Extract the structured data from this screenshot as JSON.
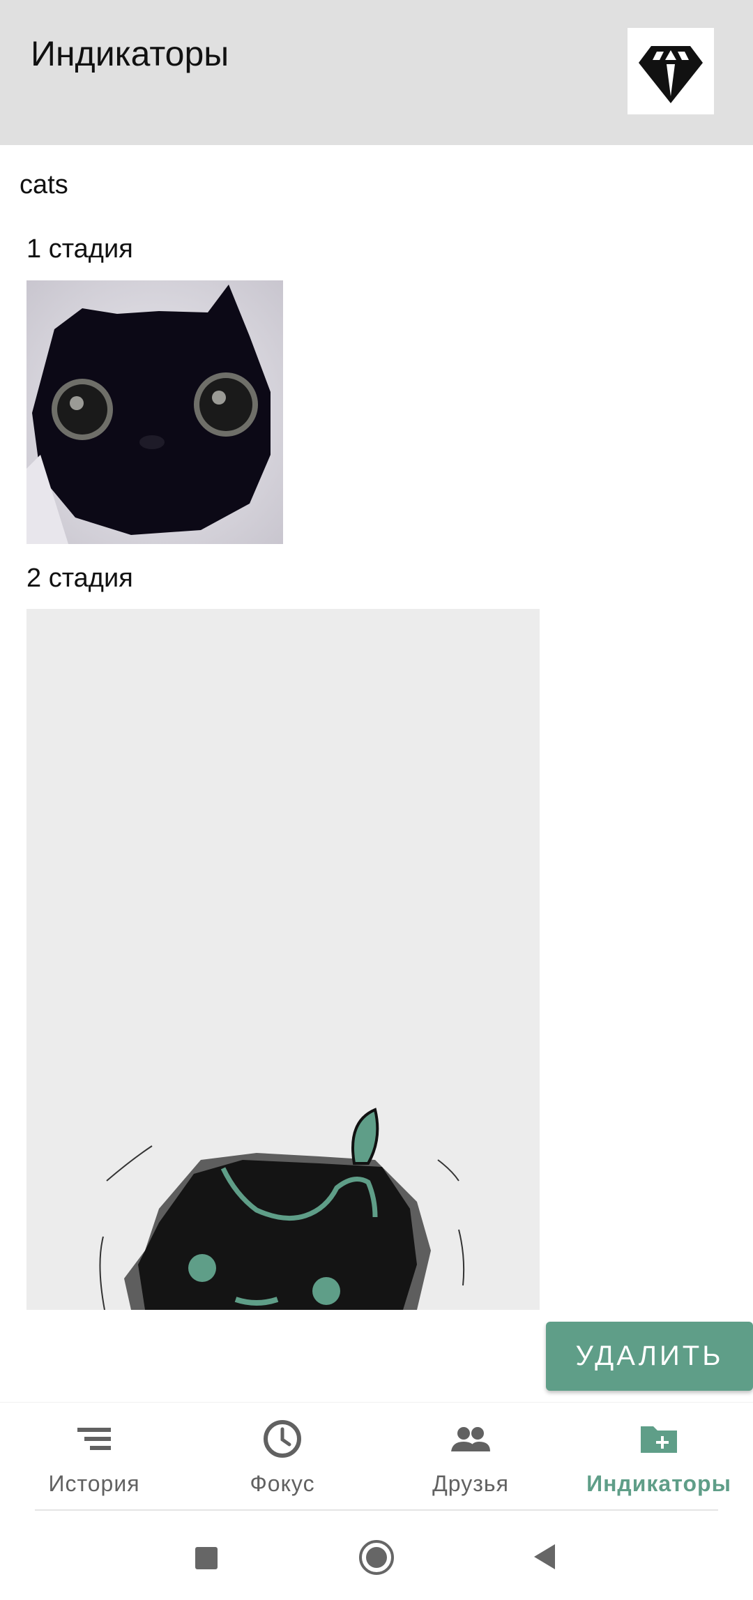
{
  "app_bar": {
    "title": "Индикаторы",
    "logo_icon": "diamond-icon"
  },
  "indicator": {
    "name": "cats"
  },
  "stages": [
    {
      "label": "1 стадия",
      "image": "black-cat-photo"
    },
    {
      "label": "2 стадия",
      "image": "cat-drawing-on-gray"
    }
  ],
  "actions": {
    "delete_label": "УДАЛИТЬ"
  },
  "bottom_nav": {
    "items": [
      {
        "label": "История",
        "icon": "menu-lines-icon",
        "active": false
      },
      {
        "label": "Фокус",
        "icon": "clock-icon",
        "active": false
      },
      {
        "label": "Друзья",
        "icon": "people-icon",
        "active": false
      },
      {
        "label": "Индикаторы",
        "icon": "folder-add-icon",
        "active": true
      }
    ]
  },
  "colors": {
    "accent": "#5f9e88",
    "app_bar_bg": "#e0e0e0"
  }
}
